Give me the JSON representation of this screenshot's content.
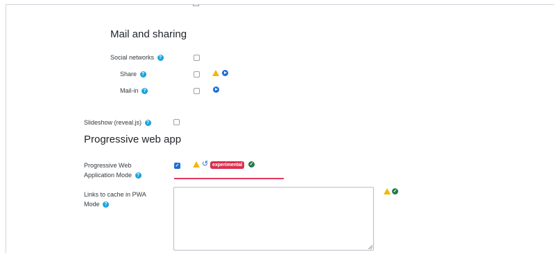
{
  "sections": {
    "mail_title": "Mail and sharing",
    "pwa_title": "Progressive web app"
  },
  "fields": {
    "social_networks": {
      "label": "Social networks",
      "checked": false
    },
    "share": {
      "label": "Share",
      "checked": false
    },
    "mail_in": {
      "label": "Mail-in",
      "checked": false
    },
    "slideshow": {
      "label": "Slideshow (reveal.js)",
      "checked": false
    },
    "pwa_mode": {
      "label_line1": "Progressive Web",
      "label_line2": "Application Mode",
      "checked": true,
      "badge": "experimental"
    },
    "links_cache": {
      "label_line1": "Links to cache in PWA",
      "label_line2": "Mode",
      "value": ""
    }
  },
  "icons": {
    "help": "?",
    "check": "✓",
    "undo": "↺"
  },
  "colors": {
    "help": "#1aa3dc",
    "warning": "#f2b705",
    "primary": "#1c6fd8",
    "ok": "#1e7a4c",
    "experimental": "#d9304e",
    "underline": "#e0365a"
  }
}
